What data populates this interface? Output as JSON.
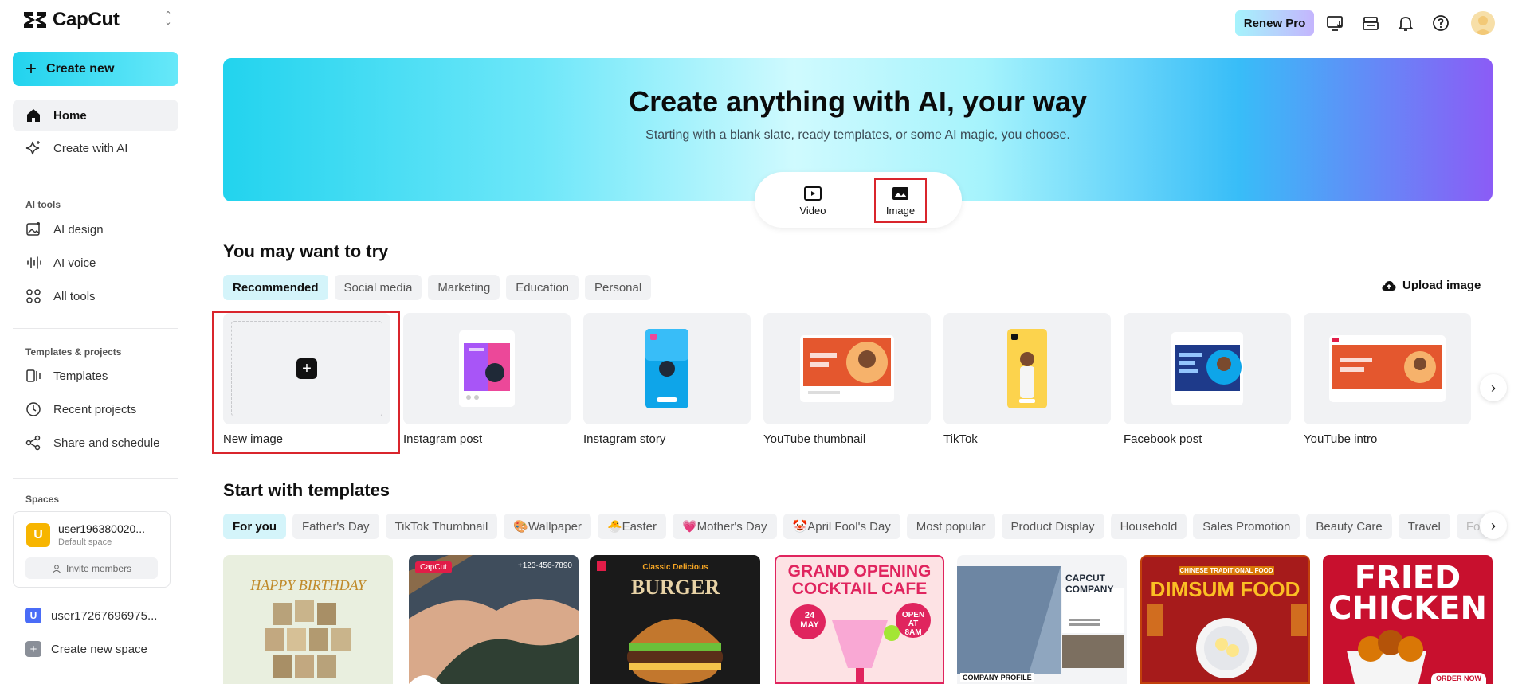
{
  "app": {
    "name": "CapCut"
  },
  "sidebar": {
    "create_label": "Create new",
    "nav_main": [
      {
        "label": "Home"
      },
      {
        "label": "Create with AI"
      }
    ],
    "ai_tools_label": "AI tools",
    "ai_tools": [
      {
        "label": "AI design"
      },
      {
        "label": "AI voice"
      },
      {
        "label": "All tools"
      }
    ],
    "templates_label": "Templates & projects",
    "templates_items": [
      {
        "label": "Templates"
      },
      {
        "label": "Recent projects"
      },
      {
        "label": "Share and schedule"
      }
    ],
    "spaces_label": "Spaces",
    "space": {
      "avatar": "U",
      "name": "user196380020...",
      "sub": "Default space",
      "invite": "Invite members"
    },
    "space2": {
      "avatar": "U",
      "name": "user17267696975..."
    },
    "new_space": "Create new space"
  },
  "topbar": {
    "renew": "Renew Pro"
  },
  "hero": {
    "title": "Create anything with AI, your way",
    "subtitle": "Starting with a blank slate, ready templates, or some AI magic, you choose.",
    "modes": [
      {
        "label": "Video"
      },
      {
        "label": "Image"
      }
    ]
  },
  "try": {
    "title": "You may want to try",
    "chips": [
      "Recommended",
      "Social media",
      "Marketing",
      "Education",
      "Personal"
    ],
    "upload": "Upload image",
    "cards": [
      {
        "label": "New image"
      },
      {
        "label": "Instagram post"
      },
      {
        "label": "Instagram story"
      },
      {
        "label": "YouTube thumbnail"
      },
      {
        "label": "TikTok"
      },
      {
        "label": "Facebook post"
      },
      {
        "label": "YouTube intro"
      }
    ]
  },
  "templates": {
    "title": "Start with templates",
    "chips": [
      "For you",
      "Father's Day",
      "TikTok Thumbnail",
      "🎨Wallpaper",
      "🐣Easter",
      "💗Mother's Day",
      "🤡April Fool's Day",
      "Most popular",
      "Product Display",
      "Household",
      "Sales Promotion",
      "Beauty Care",
      "Travel",
      "Fo"
    ],
    "cards": [
      {
        "text": "HAPPY BIRTHDAY"
      },
      {
        "text": "CapCut",
        "phone": "+123-456-7890"
      },
      {
        "text": "BURGER",
        "sub": "Classic Delicious"
      },
      {
        "text": "GRAND OPENING COCKTAIL CAFE",
        "date": "24 MAY",
        "open": "OPEN AT 8AM"
      },
      {
        "text": "CAPCUT COMPANY",
        "sub": "COMPANY PROFILE"
      },
      {
        "text": "DIMSUM FOOD",
        "sub": "CHINESE TRADITIONAL FOOD"
      },
      {
        "text": "FRIED CHICKEN",
        "sub": "ORDER NOW"
      }
    ]
  },
  "colors": {
    "accent": "#22d3ee",
    "highlight": "#d9252c"
  }
}
